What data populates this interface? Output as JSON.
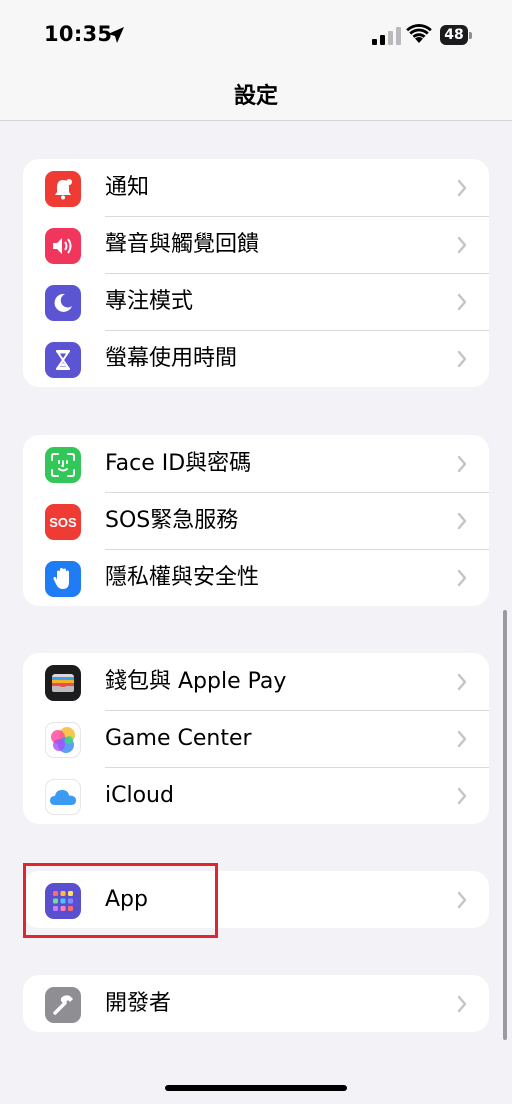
{
  "status_bar": {
    "time": "10:35",
    "battery": "48",
    "icons": [
      "location-arrow-icon",
      "cellular-signal-icon",
      "wifi-icon",
      "battery-icon"
    ]
  },
  "nav": {
    "title": "設定"
  },
  "groups": [
    {
      "items": [
        {
          "label": "通知",
          "icon": "bell-icon",
          "color": "#ee3b34"
        },
        {
          "label": "聲音與觸覺回饋",
          "icon": "speaker-icon",
          "color": "#f0365c"
        },
        {
          "label": "專注模式",
          "icon": "moon-icon",
          "color": "#5b55d4"
        },
        {
          "label": "螢幕使用時間",
          "icon": "hourglass-icon",
          "color": "#5b55d4"
        }
      ]
    },
    {
      "items": [
        {
          "label": "Face ID與密碼",
          "icon": "face-id-icon",
          "color": "#33c759"
        },
        {
          "label": "SOS緊急服務",
          "icon": "sos-icon",
          "color": "#ee3b34",
          "icon_text": "SOS"
        },
        {
          "label": "隱私權與安全性",
          "icon": "hand-icon",
          "color": "#1f7cf5"
        }
      ]
    },
    {
      "items": [
        {
          "label": "錢包與 Apple Pay",
          "icon": "wallet-icon",
          "color": "#1c1c1e"
        },
        {
          "label": "Game Center",
          "icon": "game-center-icon",
          "color": "#ffffff"
        },
        {
          "label": "iCloud",
          "icon": "icloud-icon",
          "color": "#ffffff"
        }
      ]
    },
    {
      "items": [
        {
          "label": "App",
          "icon": "apps-grid-icon",
          "color": "#5a4fcf",
          "highlighted": true
        }
      ]
    },
    {
      "items": [
        {
          "label": "開發者",
          "icon": "hammer-icon",
          "color": "#8e8e93"
        }
      ]
    }
  ],
  "chevron_icon": "chevron-right-icon",
  "highlight_color": "#e0252e"
}
